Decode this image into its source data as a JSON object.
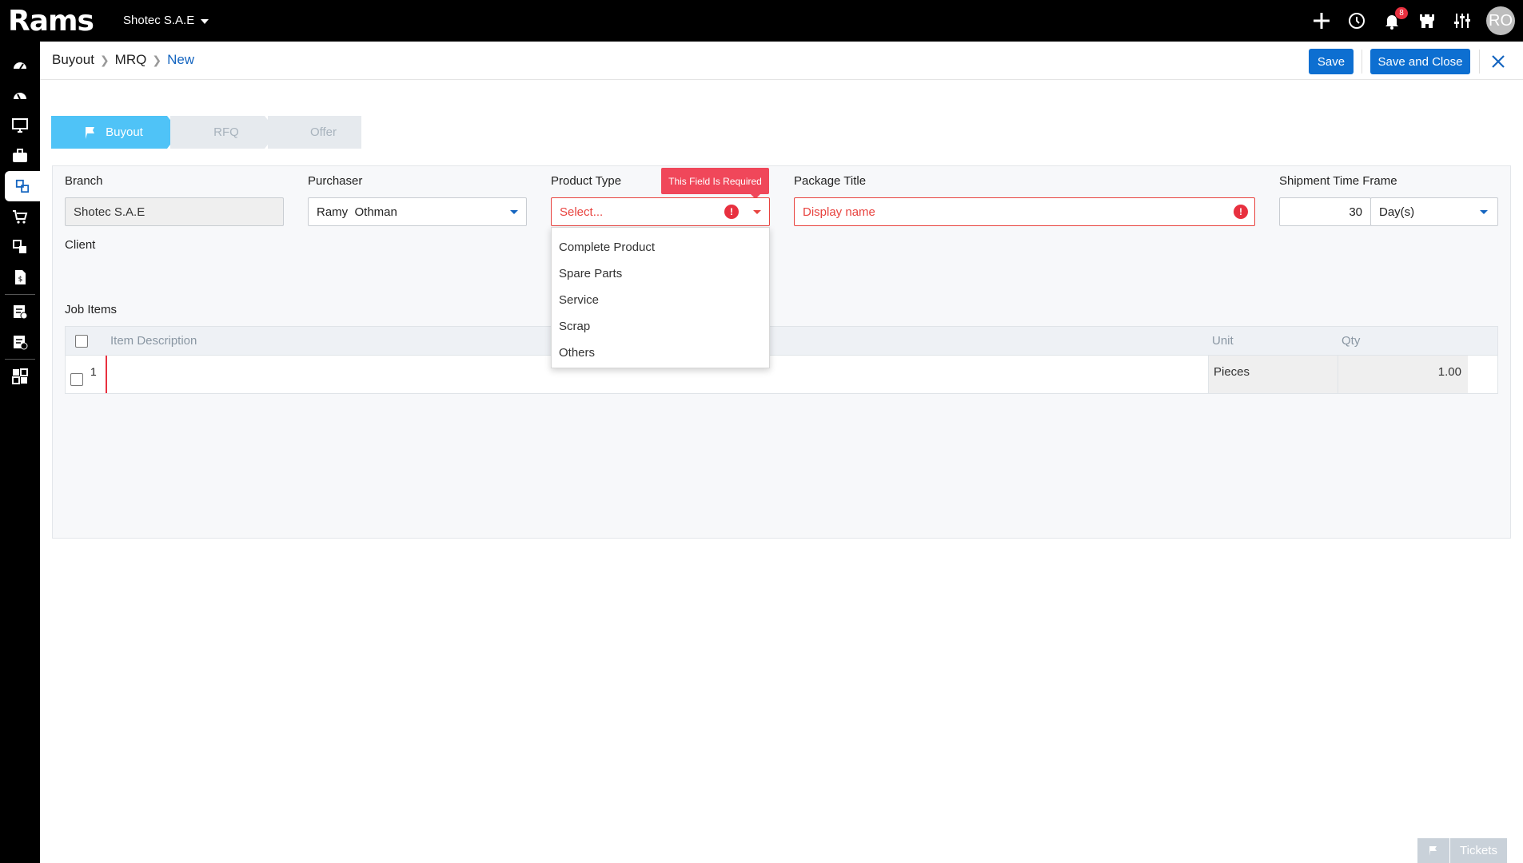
{
  "app": {
    "logo": "Rams",
    "company": "Shotec S.A.E",
    "notification_count": "8",
    "user_initials": "RO"
  },
  "breadcrumb": {
    "items": [
      "Buyout",
      "MRQ"
    ],
    "current": "New"
  },
  "actions": {
    "save": "Save",
    "save_close": "Save and Close"
  },
  "steps": [
    "Buyout",
    "RFQ",
    "Offer"
  ],
  "form": {
    "branch": {
      "label": "Branch",
      "value": "Shotec S.A.E"
    },
    "purchaser": {
      "label": "Purchaser",
      "value": "Ramy  Othman"
    },
    "product_type": {
      "label": "Product Type",
      "placeholder": "Select...",
      "error": "This Field Is Required",
      "options": [
        "Complete Product",
        "Spare Parts",
        "Service",
        "Scrap",
        "Others"
      ]
    },
    "package_title": {
      "label": "Package Title",
      "placeholder": "Display name"
    },
    "shipment": {
      "label": "Shipment Time Frame",
      "value": "30",
      "unit": "Day(s)"
    },
    "client": {
      "label": "Client"
    }
  },
  "job_items": {
    "label": "Job Items",
    "columns": {
      "description": "Item Description",
      "unit": "Unit",
      "qty": "Qty"
    },
    "rows": [
      {
        "index": "1",
        "description": "",
        "unit": "Pieces",
        "qty": "1.00"
      }
    ]
  },
  "footer": {
    "tickets": "Tickets"
  }
}
